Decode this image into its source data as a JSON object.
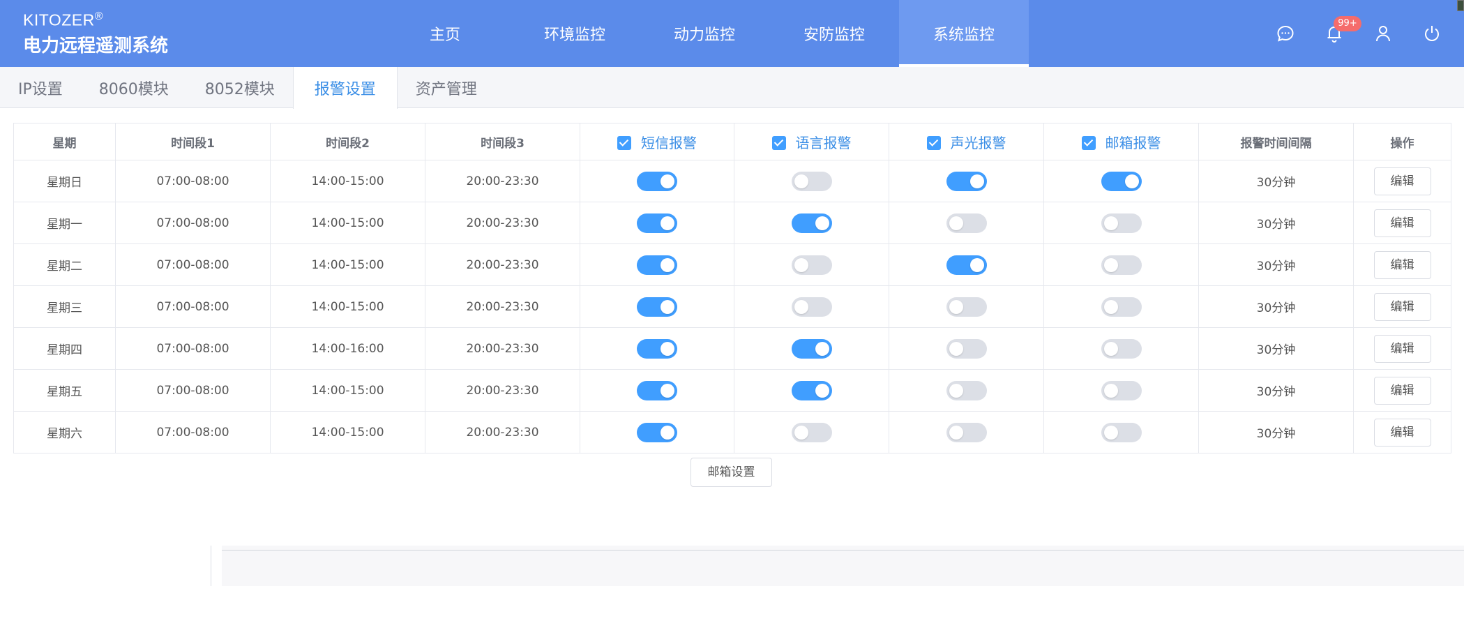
{
  "brand": {
    "name": "KITOZER",
    "reg": "®",
    "subtitle": "电力远程遥测系统"
  },
  "nav": [
    {
      "label": "主页",
      "active": false
    },
    {
      "label": "环境监控",
      "active": false
    },
    {
      "label": "动力监控",
      "active": false
    },
    {
      "label": "安防监控",
      "active": false
    },
    {
      "label": "系统监控",
      "active": true
    }
  ],
  "header_icons": [
    "chat-icon",
    "bell-icon",
    "user-icon",
    "power-icon"
  ],
  "notification_badge": "99+",
  "tabs": [
    {
      "label": "IP设置",
      "active": false
    },
    {
      "label": "8060模块",
      "active": false
    },
    {
      "label": "8052模块",
      "active": false
    },
    {
      "label": "报警设置",
      "active": true
    },
    {
      "label": "资产管理",
      "active": false
    }
  ],
  "table": {
    "headers": {
      "day": "星期",
      "slot1": "时间段1",
      "slot2": "时间段2",
      "slot3": "时间段3",
      "sms": "短信报警",
      "voice": "语言报警",
      "light": "声光报警",
      "email": "邮箱报警",
      "interval": "报警时间间隔",
      "action": "操作"
    },
    "rows": [
      {
        "day": "星期日",
        "slot1": "07:00-08:00",
        "slot2": "14:00-15:00",
        "slot3": "20:00-23:30",
        "sms": true,
        "voice": false,
        "light": true,
        "email": true,
        "interval": "30分钟",
        "action": "编辑"
      },
      {
        "day": "星期一",
        "slot1": "07:00-08:00",
        "slot2": "14:00-15:00",
        "slot3": "20:00-23:30",
        "sms": true,
        "voice": true,
        "light": false,
        "email": false,
        "interval": "30分钟",
        "action": "编辑"
      },
      {
        "day": "星期二",
        "slot1": "07:00-08:00",
        "slot2": "14:00-15:00",
        "slot3": "20:00-23:30",
        "sms": true,
        "voice": false,
        "light": true,
        "email": false,
        "interval": "30分钟",
        "action": "编辑"
      },
      {
        "day": "星期三",
        "slot1": "07:00-08:00",
        "slot2": "14:00-15:00",
        "slot3": "20:00-23:30",
        "sms": true,
        "voice": false,
        "light": false,
        "email": false,
        "interval": "30分钟",
        "action": "编辑"
      },
      {
        "day": "星期四",
        "slot1": "07:00-08:00",
        "slot2": "14:00-16:00",
        "slot3": "20:00-23:30",
        "sms": true,
        "voice": true,
        "light": false,
        "email": false,
        "interval": "30分钟",
        "action": "编辑"
      },
      {
        "day": "星期五",
        "slot1": "07:00-08:00",
        "slot2": "14:00-15:00",
        "slot3": "20:00-23:30",
        "sms": true,
        "voice": true,
        "light": false,
        "email": false,
        "interval": "30分钟",
        "action": "编辑"
      },
      {
        "day": "星期六",
        "slot1": "07:00-08:00",
        "slot2": "14:00-15:00",
        "slot3": "20:00-23:30",
        "sms": true,
        "voice": false,
        "light": false,
        "email": false,
        "interval": "30分钟",
        "action": "编辑"
      }
    ]
  },
  "email_settings_button": "邮箱设置",
  "colors": {
    "header": "#5b8bea",
    "accent": "#409eff",
    "badge": "#f56c6c"
  }
}
